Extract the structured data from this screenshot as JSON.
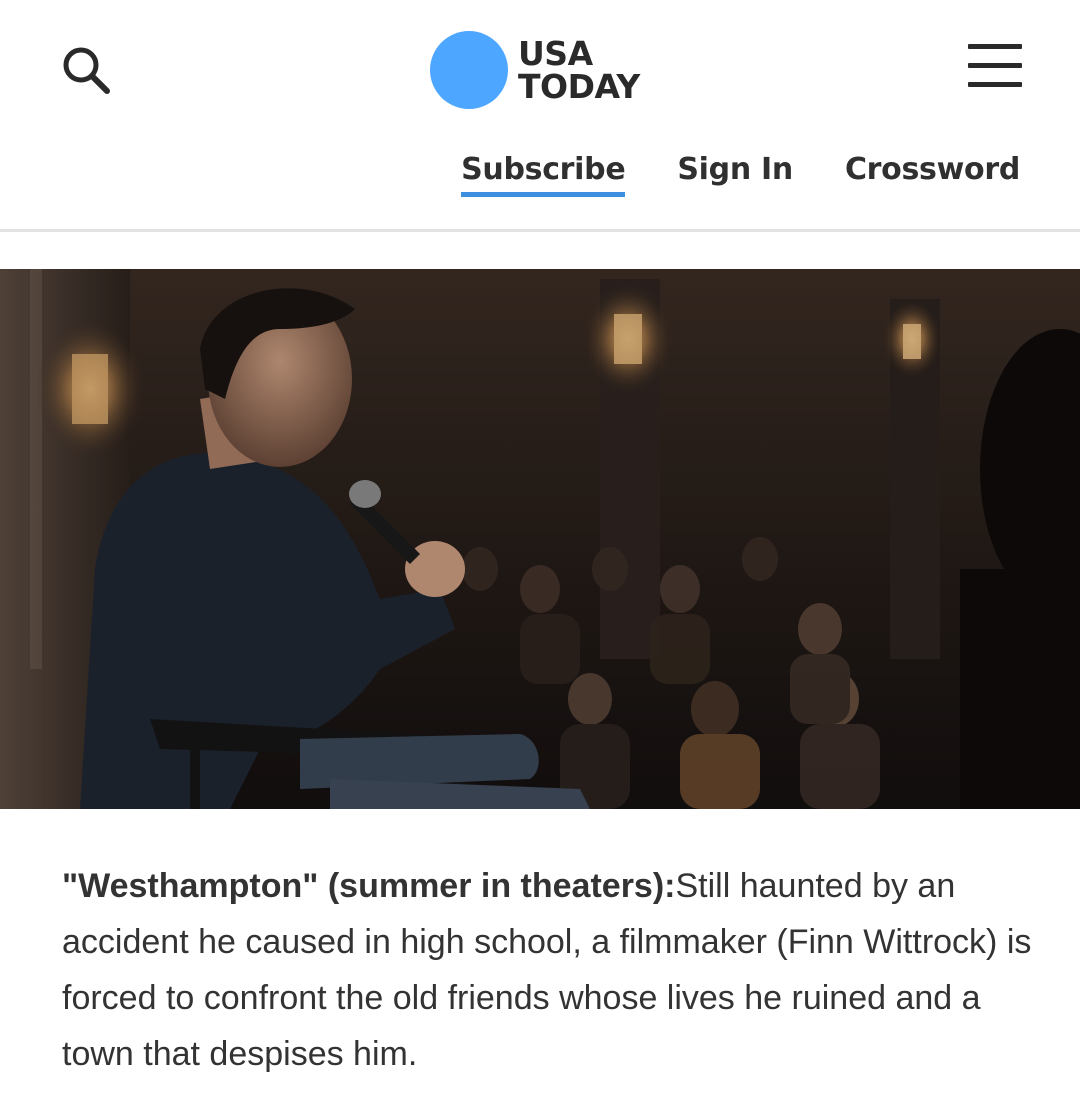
{
  "header": {
    "logo_line1": "USA",
    "logo_line2": "TODAY",
    "logo_color": "#4da6ff",
    "search_icon": "search-icon",
    "menu_icon": "hamburger-menu-icon"
  },
  "nav": {
    "subscribe": "Subscribe",
    "sign_in": "Sign In",
    "crossword": "Crossword",
    "active_underline_color": "#3d8fe0"
  },
  "article": {
    "caption_bold": "\"Westhampton\" (summer in theaters):",
    "caption_text": "Still haunted by an accident he caused in high school, a filmmaker (Finn Wittrock) is forced to confront the old friends whose lives he ruined and a town that despises him."
  }
}
